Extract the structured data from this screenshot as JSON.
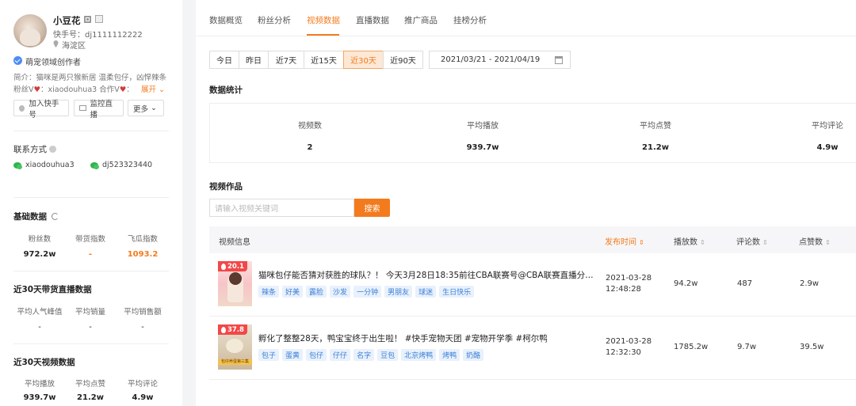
{
  "profile": {
    "name": "小豆花",
    "kuaishou_id": "快手号：dj1111112222",
    "location": "海淀区",
    "creator_tag": "萌宠领域创作者",
    "intro_line1": "简介：猫咪是两只猴新居 温柔包仔，凶悍辣条",
    "intro_line2_prefix": "粉丝V",
    "intro_line2_mid": "：xiaodouhua3 合作V",
    "intro_line2_suffix": "：",
    "expand_label": "展开",
    "buttons": {
      "add": "加入快手号",
      "monitor": "监控直播",
      "more": "更多"
    }
  },
  "contact": {
    "title": "联系方式",
    "wechat1": "xiaodouhua3",
    "wechat2": "dj523323440"
  },
  "basic": {
    "title": "基础数据",
    "items": [
      {
        "label": "粉丝数",
        "value": "972.2w"
      },
      {
        "label": "带货指数",
        "value": "-"
      },
      {
        "label": "飞瓜指数",
        "value": "1093.2"
      }
    ]
  },
  "live30": {
    "title": "近30天带货直播数据",
    "items": [
      {
        "label": "平均人气峰值",
        "value": "-"
      },
      {
        "label": "平均销量",
        "value": "-"
      },
      {
        "label": "平均销售额",
        "value": "-"
      }
    ]
  },
  "video30": {
    "title": "近30天视频数据",
    "items": [
      {
        "label": "平均播放",
        "value": "939.7w"
      },
      {
        "label": "平均点赞",
        "value": "21.2w"
      },
      {
        "label": "平均评论",
        "value": "4.9w"
      }
    ]
  },
  "tabs": [
    "数据概览",
    "粉丝分析",
    "视频数据",
    "直播数据",
    "推广商品",
    "挂榜分析"
  ],
  "active_tab": "视频数据",
  "ranges": [
    "今日",
    "昨日",
    "近7天",
    "近15天",
    "近30天",
    "近90天"
  ],
  "active_range": "近30天",
  "date_range": "2021/03/21 - 2021/04/19",
  "stats": {
    "title": "数据统计",
    "items": [
      {
        "label": "视频数",
        "value": "2"
      },
      {
        "label": "平均播放",
        "value": "939.7w"
      },
      {
        "label": "平均点赞",
        "value": "21.2w"
      },
      {
        "label": "平均评论",
        "value": "4.9w"
      }
    ]
  },
  "works": {
    "title": "视频作品",
    "search_placeholder": "请输入视频关键词",
    "search_button": "搜索",
    "columns": {
      "info": "视频信息",
      "time": "发布时间",
      "plays": "播放数",
      "comments": "评论数",
      "likes": "点赞数"
    },
    "sort_glyph": "⇕",
    "rows": [
      {
        "badge": "20.1",
        "title": "猫咪包仔能否猜对获胜的球队？！ 今天3月28日18:35前往CBA联赛号@CBA联赛直播分千万...",
        "tags": [
          "辣条",
          "好美",
          "露脸",
          "沙发",
          "一分钟",
          "男朋友",
          "球迷",
          "生日快乐"
        ],
        "date": "2021-03-28",
        "time": "12:48:28",
        "plays": "94.2w",
        "comments": "487",
        "likes": "2.9w"
      },
      {
        "badge": "37.8",
        "thumb_caption": "包仔养蛋第三集",
        "title": "孵化了整整28天，鸭宝宝终于出生啦！ #快手宠物天团 #宠物开学季 #柯尔鸭",
        "tags": [
          "包子",
          "蛋黄",
          "包仔",
          "仔仔",
          "名字",
          "豆包",
          "北京烤鸭",
          "烤鸭",
          "奶酪"
        ],
        "date": "2021-03-28",
        "time": "12:32:30",
        "plays": "1785.2w",
        "comments": "9.7w",
        "likes": "39.5w"
      }
    ]
  },
  "colors": {
    "accent": "#f37b1d",
    "tag_blue": "#3d7fd6",
    "badge_red": "#f24848",
    "wechat_green": "#2fb350"
  }
}
